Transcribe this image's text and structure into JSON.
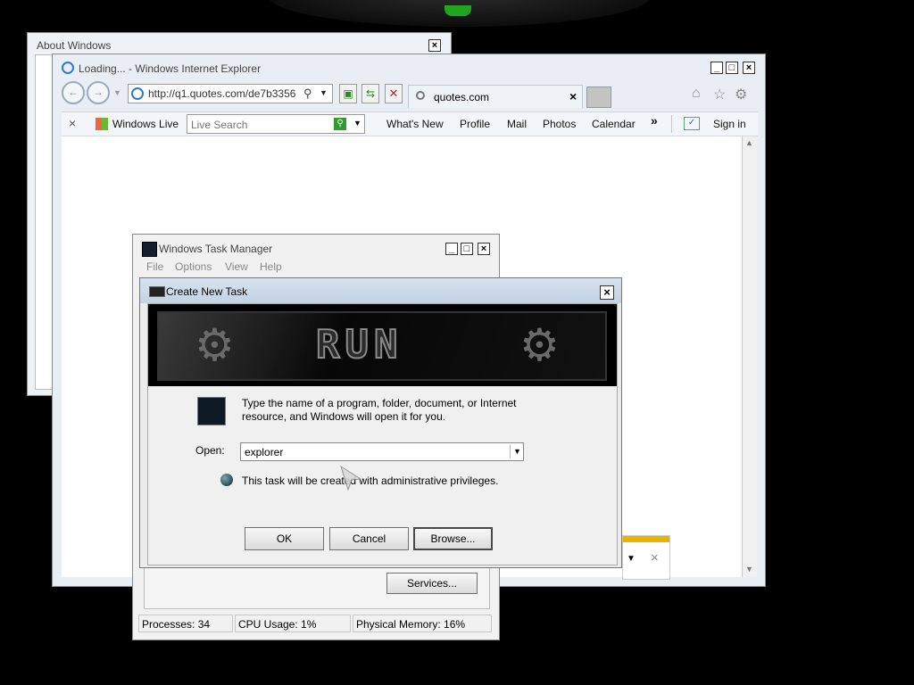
{
  "about_window": {
    "title": "About Windows",
    "close": "×"
  },
  "ie_window": {
    "title": "Loading... - Windows Internet Explorer",
    "address": "http://q1.quotes.com/de7b3356",
    "tab_label": "quotes.com",
    "tab_close": "×",
    "min": "_",
    "max": "□",
    "close": "×",
    "toolbar_close": "×",
    "windows_live": "Windows Live",
    "search_placeholder": "Live Search",
    "links": [
      "What's New",
      "Profile",
      "Mail",
      "Photos",
      "Calendar"
    ],
    "more": "»",
    "sign_in": "Sign in",
    "info_close": "×"
  },
  "task_manager": {
    "title": "Windows Task Manager",
    "menu": [
      "File",
      "Options",
      "View",
      "Help"
    ],
    "services_button": "Services...",
    "status": {
      "processes": "Processes: 34",
      "cpu": "CPU Usage: 1%",
      "memory": "Physical Memory: 16%"
    },
    "min": "_",
    "max": "□",
    "close": "×"
  },
  "run_dialog": {
    "title": "Create New Task",
    "close": "×",
    "banner_text": "RUN",
    "description": "Type the name of a program, folder, document, or Internet resource, and Windows will open it for you.",
    "open_label": "Open:",
    "open_value": "explorer",
    "admin_note": "This task will be created with administrative privileges.",
    "ok": "OK",
    "cancel": "Cancel",
    "browse": "Browse..."
  },
  "colors": {
    "accent_green": "#1fa51f",
    "notify_yellow": "#e8b400"
  }
}
